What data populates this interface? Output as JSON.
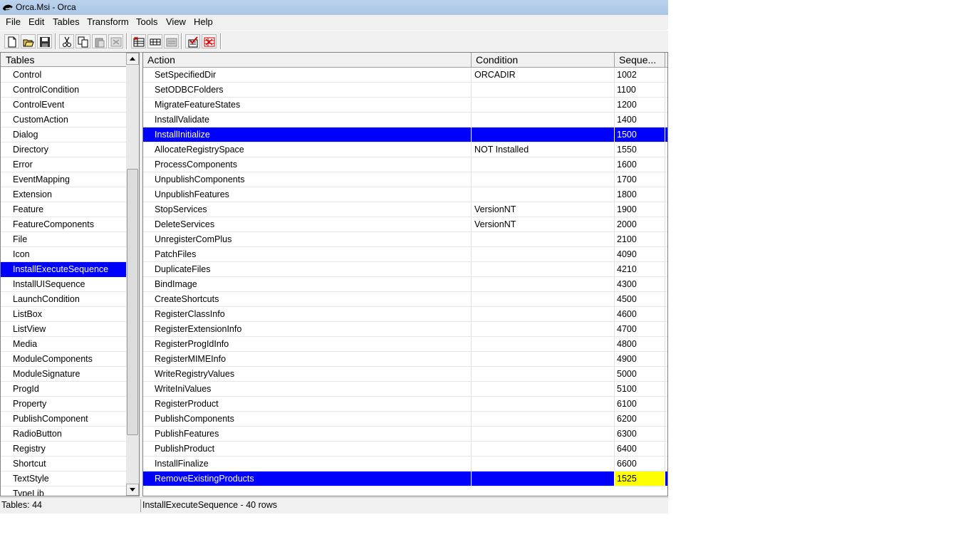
{
  "window": {
    "title": "Orca.Msi - Orca"
  },
  "menu": [
    "File",
    "Edit",
    "Tables",
    "Transform",
    "Tools",
    "View",
    "Help"
  ],
  "toolbar": [
    "new-file-icon",
    "open-folder-icon",
    "save-icon",
    "cut-icon",
    "copy-icon",
    "paste-icon",
    "drop-table-icon",
    "add-table-icon",
    "add-row-icon",
    "edit-row-icon",
    "validate-icon",
    "transform-icon"
  ],
  "tables_pane": {
    "header": "Tables",
    "items": [
      "Control",
      "ControlCondition",
      "ControlEvent",
      "CustomAction",
      "Dialog",
      "Directory",
      "Error",
      "EventMapping",
      "Extension",
      "Feature",
      "FeatureComponents",
      "File",
      "Icon",
      "InstallExecuteSequence",
      "InstallUISequence",
      "LaunchCondition",
      "ListBox",
      "ListView",
      "Media",
      "ModuleComponents",
      "ModuleSignature",
      "ProgId",
      "Property",
      "PublishComponent",
      "RadioButton",
      "Registry",
      "Shortcut",
      "TextStyle",
      "TypeLib"
    ],
    "selected": "InstallExecuteSequence"
  },
  "grid": {
    "columns": [
      "Action",
      "Condition",
      "Seque..."
    ],
    "rows": [
      {
        "action": "SetSpecifiedDir",
        "condition": "ORCADIR",
        "sequence": "1002"
      },
      {
        "action": "SetODBCFolders",
        "condition": "",
        "sequence": "1100"
      },
      {
        "action": "MigrateFeatureStates",
        "condition": "",
        "sequence": "1200"
      },
      {
        "action": "InstallValidate",
        "condition": "",
        "sequence": "1400"
      },
      {
        "action": "InstallInitialize",
        "condition": "",
        "sequence": "1500",
        "selected": true
      },
      {
        "action": "AllocateRegistrySpace",
        "condition": "NOT Installed",
        "sequence": "1550"
      },
      {
        "action": "ProcessComponents",
        "condition": "",
        "sequence": "1600"
      },
      {
        "action": "UnpublishComponents",
        "condition": "",
        "sequence": "1700"
      },
      {
        "action": "UnpublishFeatures",
        "condition": "",
        "sequence": "1800"
      },
      {
        "action": "StopServices",
        "condition": "VersionNT",
        "sequence": "1900"
      },
      {
        "action": "DeleteServices",
        "condition": "VersionNT",
        "sequence": "2000"
      },
      {
        "action": "UnregisterComPlus",
        "condition": "",
        "sequence": "2100"
      },
      {
        "action": "PatchFiles",
        "condition": "",
        "sequence": "4090"
      },
      {
        "action": "DuplicateFiles",
        "condition": "",
        "sequence": "4210"
      },
      {
        "action": "BindImage",
        "condition": "",
        "sequence": "4300"
      },
      {
        "action": "CreateShortcuts",
        "condition": "",
        "sequence": "4500"
      },
      {
        "action": "RegisterClassInfo",
        "condition": "",
        "sequence": "4600"
      },
      {
        "action": "RegisterExtensionInfo",
        "condition": "",
        "sequence": "4700"
      },
      {
        "action": "RegisterProgIdInfo",
        "condition": "",
        "sequence": "4800"
      },
      {
        "action": "RegisterMIMEInfo",
        "condition": "",
        "sequence": "4900"
      },
      {
        "action": "WriteRegistryValues",
        "condition": "",
        "sequence": "5000"
      },
      {
        "action": "WriteIniValues",
        "condition": "",
        "sequence": "5100"
      },
      {
        "action": "RegisterProduct",
        "condition": "",
        "sequence": "6100"
      },
      {
        "action": "PublishComponents",
        "condition": "",
        "sequence": "6200"
      },
      {
        "action": "PublishFeatures",
        "condition": "",
        "sequence": "6300"
      },
      {
        "action": "PublishProduct",
        "condition": "",
        "sequence": "6400"
      },
      {
        "action": "InstallFinalize",
        "condition": "",
        "sequence": "6600"
      },
      {
        "action": "RemoveExistingProducts",
        "condition": "",
        "sequence": "1525",
        "selected": true,
        "highlight_sequence": true
      }
    ]
  },
  "status": {
    "left": "Tables: 44",
    "right": "InstallExecuteSequence - 40 rows"
  },
  "colors": {
    "selection": "#0000ff",
    "highlight": "#ffff00"
  }
}
